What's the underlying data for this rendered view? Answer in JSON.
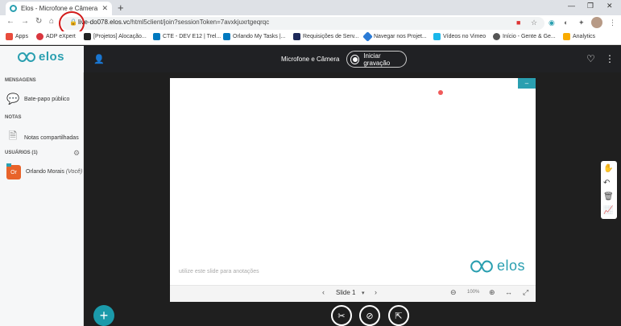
{
  "browser": {
    "tab_title": "Elos - Microfone e Câmera",
    "tab_close": "✕",
    "new_tab": "+",
    "url_prefix": "live-do078.elos.vc",
    "url_rest": "/html5client/join?sessionToken=7avxkjuxrtgeqrqc"
  },
  "bookmarks": [
    {
      "label": "Apps",
      "color": "#e84c3d"
    },
    {
      "label": "ADP eXpert",
      "color": "#d9363e"
    },
    {
      "label": "[Projetos] Alocação...",
      "color": "#222"
    },
    {
      "label": "CTE - DEV E12 | Trel...",
      "color": "#0079bf"
    },
    {
      "label": "Orlando My Tasks |...",
      "color": "#0079bf"
    },
    {
      "label": "Requisições de Serv...",
      "color": "#1e2a5a"
    },
    {
      "label": "Navegar nos Projet...",
      "color": "#2b7bd6"
    },
    {
      "label": "Vídeos no Vimeo",
      "color": "#1ab7ea"
    },
    {
      "label": "Início - Gente & Ge...",
      "color": "#555"
    },
    {
      "label": "Analytics",
      "color": "#f9ab00"
    }
  ],
  "app": {
    "logo_text": "elos",
    "session_title": "Microfone e Câmera",
    "record_label": "Iniciar gravação"
  },
  "sidebar": {
    "messages_title": "MENSAGENS",
    "public_chat": "Bate-papo público",
    "notes_title": "NOTAS",
    "shared_notes": "Notas compartilhadas",
    "users_title": "USUÁRIOS (1)",
    "user_initials": "Or",
    "user_name": "Orlando Morais",
    "user_you": "(Você)"
  },
  "presentation": {
    "minimize": "–",
    "note": "utilize este slide para anotações",
    "logo_text": "elos",
    "slide_label": "Slide 1",
    "zoom": "100%"
  },
  "colors": {
    "accent": "#2a9fb0",
    "dark": "#1f1f1f",
    "highlight": "#d21b1b"
  }
}
